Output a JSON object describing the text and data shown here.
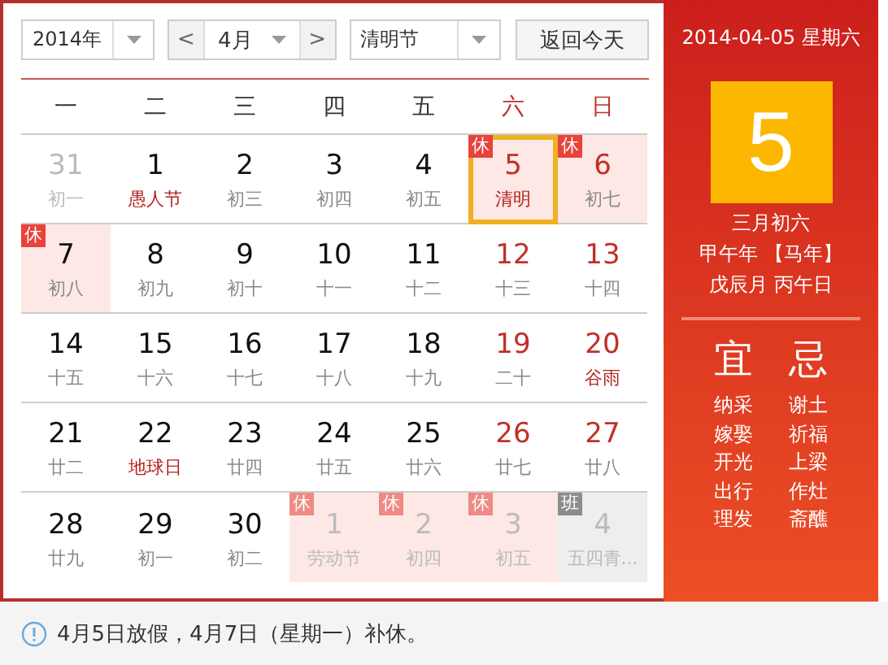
{
  "toolbar": {
    "year": "2014年",
    "prev": "<",
    "month": "4月",
    "next": ">",
    "holiday": "清明节",
    "today_button": "返回今天"
  },
  "weekdays": [
    {
      "label": "一",
      "weekend": false
    },
    {
      "label": "二",
      "weekend": false
    },
    {
      "label": "三",
      "weekend": false
    },
    {
      "label": "四",
      "weekend": false
    },
    {
      "label": "五",
      "weekend": false
    },
    {
      "label": "六",
      "weekend": true
    },
    {
      "label": "日",
      "weekend": true
    }
  ],
  "days": [
    {
      "day": "31",
      "sub": "初一",
      "outside": true,
      "weekend": false,
      "festival": false,
      "selected": false
    },
    {
      "day": "1",
      "sub": "愚人节",
      "outside": false,
      "weekend": false,
      "festival": true,
      "selected": false
    },
    {
      "day": "2",
      "sub": "初三",
      "outside": false,
      "weekend": false,
      "festival": false,
      "selected": false
    },
    {
      "day": "3",
      "sub": "初四",
      "outside": false,
      "weekend": false,
      "festival": false,
      "selected": false
    },
    {
      "day": "4",
      "sub": "初五",
      "outside": false,
      "weekend": false,
      "festival": false,
      "selected": false
    },
    {
      "day": "5",
      "sub": "清明",
      "outside": false,
      "weekend": true,
      "festival": true,
      "selected": true,
      "badge": {
        "text": "休",
        "kind": "rest"
      }
    },
    {
      "day": "6",
      "sub": "初七",
      "outside": false,
      "weekend": true,
      "festival": false,
      "selected": false,
      "badge": {
        "text": "休",
        "kind": "rest"
      }
    },
    {
      "day": "7",
      "sub": "初八",
      "outside": false,
      "weekend": false,
      "festival": false,
      "selected": false,
      "badge": {
        "text": "休",
        "kind": "rest"
      }
    },
    {
      "day": "8",
      "sub": "初九",
      "outside": false,
      "weekend": false,
      "festival": false,
      "selected": false
    },
    {
      "day": "9",
      "sub": "初十",
      "outside": false,
      "weekend": false,
      "festival": false,
      "selected": false
    },
    {
      "day": "10",
      "sub": "十一",
      "outside": false,
      "weekend": false,
      "festival": false,
      "selected": false
    },
    {
      "day": "11",
      "sub": "十二",
      "outside": false,
      "weekend": false,
      "festival": false,
      "selected": false
    },
    {
      "day": "12",
      "sub": "十三",
      "outside": false,
      "weekend": true,
      "festival": false,
      "selected": false
    },
    {
      "day": "13",
      "sub": "十四",
      "outside": false,
      "weekend": true,
      "festival": false,
      "selected": false
    },
    {
      "day": "14",
      "sub": "十五",
      "outside": false,
      "weekend": false,
      "festival": false,
      "selected": false
    },
    {
      "day": "15",
      "sub": "十六",
      "outside": false,
      "weekend": false,
      "festival": false,
      "selected": false
    },
    {
      "day": "16",
      "sub": "十七",
      "outside": false,
      "weekend": false,
      "festival": false,
      "selected": false
    },
    {
      "day": "17",
      "sub": "十八",
      "outside": false,
      "weekend": false,
      "festival": false,
      "selected": false
    },
    {
      "day": "18",
      "sub": "十九",
      "outside": false,
      "weekend": false,
      "festival": false,
      "selected": false
    },
    {
      "day": "19",
      "sub": "二十",
      "outside": false,
      "weekend": true,
      "festival": false,
      "selected": false
    },
    {
      "day": "20",
      "sub": "谷雨",
      "outside": false,
      "weekend": true,
      "festival": true,
      "selected": false
    },
    {
      "day": "21",
      "sub": "廿二",
      "outside": false,
      "weekend": false,
      "festival": false,
      "selected": false
    },
    {
      "day": "22",
      "sub": "地球日",
      "outside": false,
      "weekend": false,
      "festival": true,
      "selected": false
    },
    {
      "day": "23",
      "sub": "廿四",
      "outside": false,
      "weekend": false,
      "festival": false,
      "selected": false
    },
    {
      "day": "24",
      "sub": "廿五",
      "outside": false,
      "weekend": false,
      "festival": false,
      "selected": false
    },
    {
      "day": "25",
      "sub": "廿六",
      "outside": false,
      "weekend": false,
      "festival": false,
      "selected": false
    },
    {
      "day": "26",
      "sub": "廿七",
      "outside": false,
      "weekend": true,
      "festival": false,
      "selected": false
    },
    {
      "day": "27",
      "sub": "廿八",
      "outside": false,
      "weekend": true,
      "festival": false,
      "selected": false
    },
    {
      "day": "28",
      "sub": "廿九",
      "outside": false,
      "weekend": false,
      "festival": false,
      "selected": false
    },
    {
      "day": "29",
      "sub": "初一",
      "outside": false,
      "weekend": false,
      "festival": false,
      "selected": false
    },
    {
      "day": "30",
      "sub": "初二",
      "outside": false,
      "weekend": false,
      "festival": false,
      "selected": false
    },
    {
      "day": "1",
      "sub": "劳动节",
      "outside": true,
      "weekend": false,
      "festival": true,
      "selected": false,
      "badge": {
        "text": "休",
        "kind": "rest"
      }
    },
    {
      "day": "2",
      "sub": "初四",
      "outside": true,
      "weekend": false,
      "festival": false,
      "selected": false,
      "badge": {
        "text": "休",
        "kind": "rest"
      }
    },
    {
      "day": "3",
      "sub": "初五",
      "outside": true,
      "weekend": true,
      "festival": false,
      "selected": false,
      "badge": {
        "text": "休",
        "kind": "rest"
      }
    },
    {
      "day": "4",
      "sub": "五四青...",
      "outside": true,
      "weekend": true,
      "festival": true,
      "selected": false,
      "badge": {
        "text": "班",
        "kind": "work"
      }
    }
  ],
  "detail": {
    "date": "2014-04-05 星期六",
    "big_day": "5",
    "lunar": [
      "三月初六",
      "甲午年 【马年】",
      "戊辰月 丙午日"
    ],
    "good": {
      "title": "宜",
      "items": [
        "纳采",
        "嫁娶",
        "开光",
        "出行",
        "理发"
      ]
    },
    "bad": {
      "title": "忌",
      "items": [
        "谢土",
        "祈福",
        "上梁",
        "作灶",
        "斋醮"
      ]
    }
  },
  "notice": "4月5日放假，4月7日（星期一）补休。"
}
